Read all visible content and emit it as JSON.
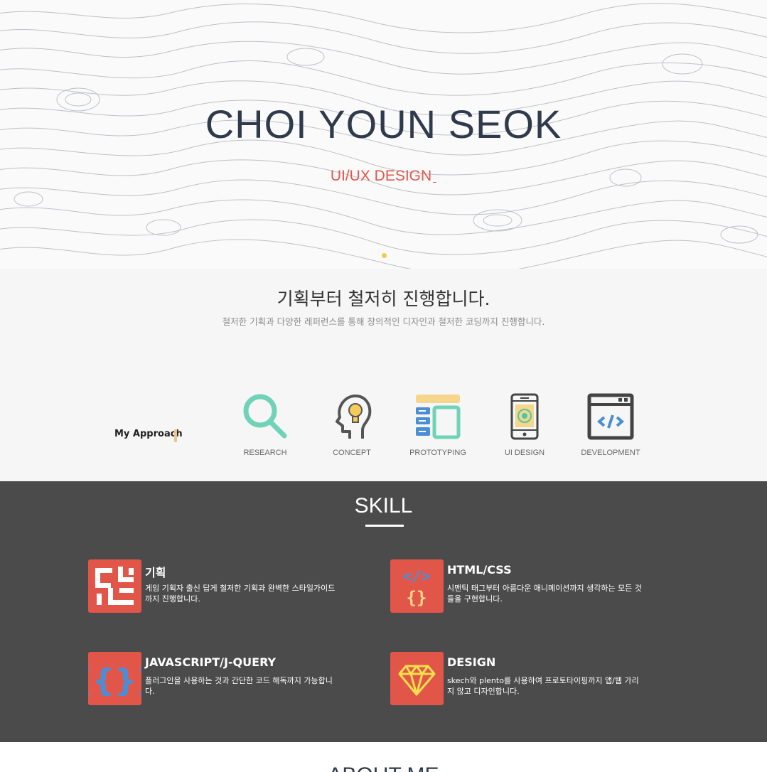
{
  "hero": {
    "title": "CHOI YOUN SEOK",
    "subtitle": "UI/UX DESIGN",
    "accent_color": "#e2564a",
    "title_color": "#2f3a4c"
  },
  "approach": {
    "title": "기획부터 철저히 진행합니다.",
    "description": "철저한 기획과 다양한 레퍼런스를 통해 창의적인 디자인과 철저한 코딩까지 진행합니다.",
    "label": "My Approach",
    "items": [
      {
        "label": "RESEARCH",
        "icon": "magnifier-icon"
      },
      {
        "label": "CONCEPT",
        "icon": "head-lightbulb-icon"
      },
      {
        "label": "PROTOTYPING",
        "icon": "layout-blocks-icon"
      },
      {
        "label": "UI DESIGN",
        "icon": "mobile-phone-icon"
      },
      {
        "label": "DEVELOPMENT",
        "icon": "browser-code-icon"
      }
    ]
  },
  "skill": {
    "title": "SKILL",
    "items": [
      {
        "name": "기획",
        "desc": "게임 기획자 출신 답게 철저한 기획과 완벽한 스타일가이드까지 진행합니다.",
        "icon": "maze-icon"
      },
      {
        "name": "HTML/CSS",
        "desc": "시맨틱 태그부터 아름다운 애니메이션까지 생각하는 모든 것들을 구현합니다.",
        "icon": "code-brackets-icon"
      },
      {
        "name": "JAVASCRIPT/J-QUERY",
        "desc": "플러그인을 사용하는 것과 간단한 코드 해독까지 가능합니다.",
        "icon": "curly-braces-icon"
      },
      {
        "name": "DESIGN",
        "desc": "skech와 plento를 사용하여 프로토타이핑까지 앱/웹 가리지 않고 디자인합니다.",
        "icon": "diamond-icon"
      }
    ]
  },
  "about": {
    "title": "ABOUT ME"
  }
}
